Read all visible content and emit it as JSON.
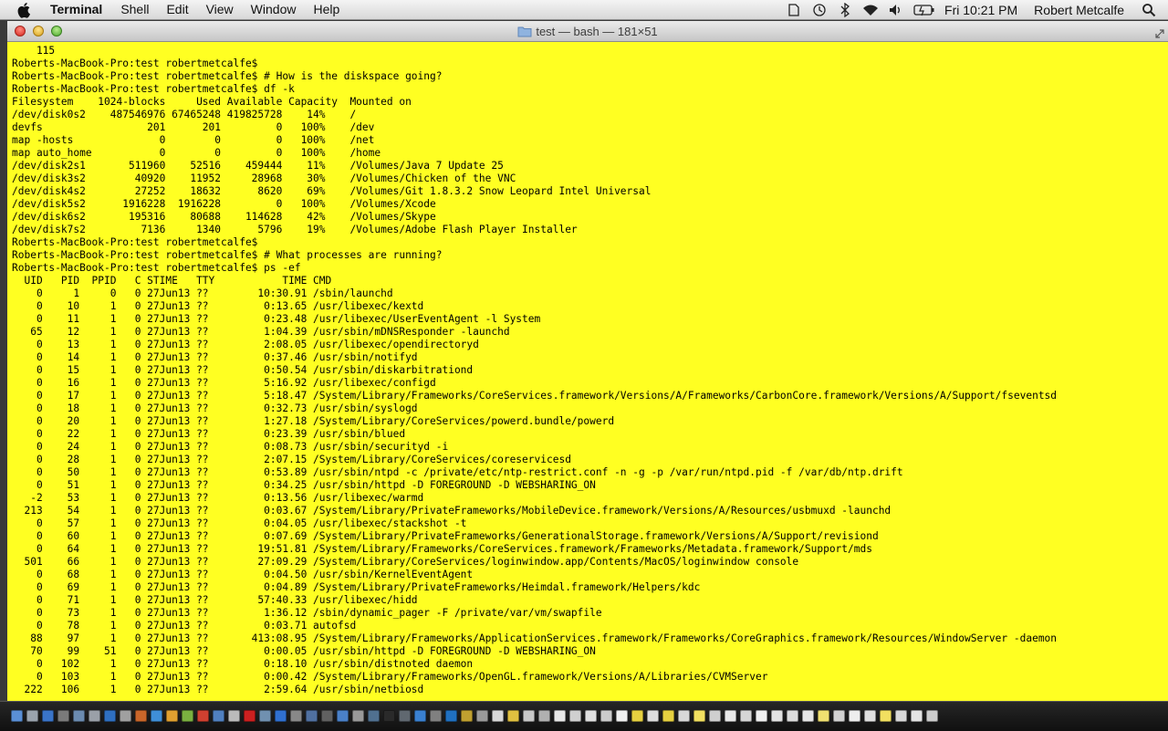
{
  "menubar": {
    "app_name": "Terminal",
    "menus": [
      "Shell",
      "Edit",
      "View",
      "Window",
      "Help"
    ],
    "clock": "Fri 10:21 PM",
    "user": "Robert Metcalfe",
    "icons": [
      "apple-icon",
      "dropbox-icon",
      "time-machine-icon",
      "bluetooth-icon",
      "wifi-icon",
      "volume-icon",
      "battery-icon",
      "spotlight-icon"
    ]
  },
  "window": {
    "title": "test — bash — 181×51"
  },
  "terminal": {
    "lines": [
      "    115",
      "Roberts-MacBook-Pro:test robertmetcalfe$",
      "Roberts-MacBook-Pro:test robertmetcalfe$ # How is the diskspace going?",
      "Roberts-MacBook-Pro:test robertmetcalfe$ df -k",
      "Filesystem    1024-blocks     Used Available Capacity  Mounted on",
      "/dev/disk0s2    487546976 67465248 419825728    14%    /",
      "devfs                 201      201         0   100%    /dev",
      "map -hosts              0        0         0   100%    /net",
      "map auto_home           0        0         0   100%    /home",
      "/dev/disk2s1       511960    52516    459444    11%    /Volumes/Java 7 Update 25",
      "/dev/disk3s2        40920    11952     28968    30%    /Volumes/Chicken of the VNC",
      "/dev/disk4s2        27252    18632      8620    69%    /Volumes/Git 1.8.3.2 Snow Leopard Intel Universal",
      "/dev/disk5s2      1916228  1916228         0   100%    /Volumes/Xcode",
      "/dev/disk6s2       195316    80688    114628    42%    /Volumes/Skype",
      "/dev/disk7s2         7136     1340      5796    19%    /Volumes/Adobe Flash Player Installer",
      "Roberts-MacBook-Pro:test robertmetcalfe$",
      "Roberts-MacBook-Pro:test robertmetcalfe$ # What processes are running?",
      "Roberts-MacBook-Pro:test robertmetcalfe$ ps -ef",
      "  UID   PID  PPID   C STIME   TTY           TIME CMD",
      "    0     1     0   0 27Jun13 ??        10:30.91 /sbin/launchd",
      "    0    10     1   0 27Jun13 ??         0:13.65 /usr/libexec/kextd",
      "    0    11     1   0 27Jun13 ??         0:23.48 /usr/libexec/UserEventAgent -l System",
      "   65    12     1   0 27Jun13 ??         1:04.39 /usr/sbin/mDNSResponder -launchd",
      "    0    13     1   0 27Jun13 ??         2:08.05 /usr/libexec/opendirectoryd",
      "    0    14     1   0 27Jun13 ??         0:37.46 /usr/sbin/notifyd",
      "    0    15     1   0 27Jun13 ??         0:50.54 /usr/sbin/diskarbitrationd",
      "    0    16     1   0 27Jun13 ??         5:16.92 /usr/libexec/configd",
      "    0    17     1   0 27Jun13 ??         5:18.47 /System/Library/Frameworks/CoreServices.framework/Versions/A/Frameworks/CarbonCore.framework/Versions/A/Support/fseventsd",
      "    0    18     1   0 27Jun13 ??         0:32.73 /usr/sbin/syslogd",
      "    0    20     1   0 27Jun13 ??         1:27.18 /System/Library/CoreServices/powerd.bundle/powerd",
      "    0    22     1   0 27Jun13 ??         0:23.39 /usr/sbin/blued",
      "    0    24     1   0 27Jun13 ??         0:08.73 /usr/sbin/securityd -i",
      "    0    28     1   0 27Jun13 ??         2:07.15 /System/Library/CoreServices/coreservicesd",
      "    0    50     1   0 27Jun13 ??         0:53.89 /usr/sbin/ntpd -c /private/etc/ntp-restrict.conf -n -g -p /var/run/ntpd.pid -f /var/db/ntp.drift",
      "    0    51     1   0 27Jun13 ??         0:34.25 /usr/sbin/httpd -D FOREGROUND -D WEBSHARING_ON",
      "   -2    53     1   0 27Jun13 ??         0:13.56 /usr/libexec/warmd",
      "  213    54     1   0 27Jun13 ??         0:03.67 /System/Library/PrivateFrameworks/MobileDevice.framework/Versions/A/Resources/usbmuxd -launchd",
      "    0    57     1   0 27Jun13 ??         0:04.05 /usr/libexec/stackshot -t",
      "    0    60     1   0 27Jun13 ??         0:07.69 /System/Library/PrivateFrameworks/GenerationalStorage.framework/Versions/A/Support/revisiond",
      "    0    64     1   0 27Jun13 ??        19:51.81 /System/Library/Frameworks/CoreServices.framework/Frameworks/Metadata.framework/Support/mds",
      "  501    66     1   0 27Jun13 ??        27:09.29 /System/Library/CoreServices/loginwindow.app/Contents/MacOS/loginwindow console",
      "    0    68     1   0 27Jun13 ??         0:04.50 /usr/sbin/KernelEventAgent",
      "    0    69     1   0 27Jun13 ??         0:04.89 /System/Library/PrivateFrameworks/Heimdal.framework/Helpers/kdc",
      "    0    71     1   0 27Jun13 ??        57:40.33 /usr/libexec/hidd",
      "    0    73     1   0 27Jun13 ??         1:36.12 /sbin/dynamic_pager -F /private/var/vm/swapfile",
      "    0    78     1   0 27Jun13 ??         0:03.71 autofsd",
      "   88    97     1   0 27Jun13 ??       413:08.95 /System/Library/Frameworks/ApplicationServices.framework/Frameworks/CoreGraphics.framework/Resources/WindowServer -daemon",
      "   70    99    51   0 27Jun13 ??         0:00.05 /usr/sbin/httpd -D FOREGROUND -D WEBSHARING_ON",
      "    0   102     1   0 27Jun13 ??         0:18.10 /usr/sbin/distnoted daemon",
      "    0   103     1   0 27Jun13 ??         0:00.42 /System/Library/Frameworks/OpenGL.framework/Versions/A/Libraries/CVMServer",
      "  222   106     1   0 27Jun13 ??         2:59.64 /usr/sbin/netbiosd"
    ]
  },
  "colors": {
    "terminal_background": "#ffff22",
    "terminal_text": "#000000"
  },
  "dock": {
    "icon_colors": [
      "#5a8fd6",
      "#9aa3ad",
      "#3a74c8",
      "#7a7a7a",
      "#6b8bb0",
      "#9aa0a8",
      "#2f6fc0",
      "#a0a0a0",
      "#c9662a",
      "#3f8fd8",
      "#e0a030",
      "#7ab040",
      "#d04030",
      "#5080c0",
      "#bbbbbb",
      "#cc2020",
      "#7090b0",
      "#3070d0",
      "#888888",
      "#5070a0",
      "#606060",
      "#4a80c8",
      "#999999",
      "#507090",
      "#2a2a2a",
      "#606870",
      "#3a80d0",
      "#808080",
      "#2070c0",
      "#c0a030",
      "#9a9a9a",
      "#d8d8d8",
      "#e0c040",
      "#c8c8c8",
      "#b0b0b0",
      "#e8e8e8",
      "#d0d0d0",
      "#e0e0e0",
      "#cccccc",
      "#f0f0f0",
      "#e6d040",
      "#dddddd",
      "#e6d040",
      "#d8d8d8",
      "#f2e060",
      "#cfcfcf",
      "#e8e8e8",
      "#d6d6d6",
      "#f0f0f0",
      "#e2e2e2",
      "#dcdcdc",
      "#e6e6e6",
      "#f0e070",
      "#d2d2d2",
      "#eeeeee",
      "#e0e0e0",
      "#f2e060",
      "#d8d8d8",
      "#e4e4e4",
      "#cccccc"
    ]
  }
}
